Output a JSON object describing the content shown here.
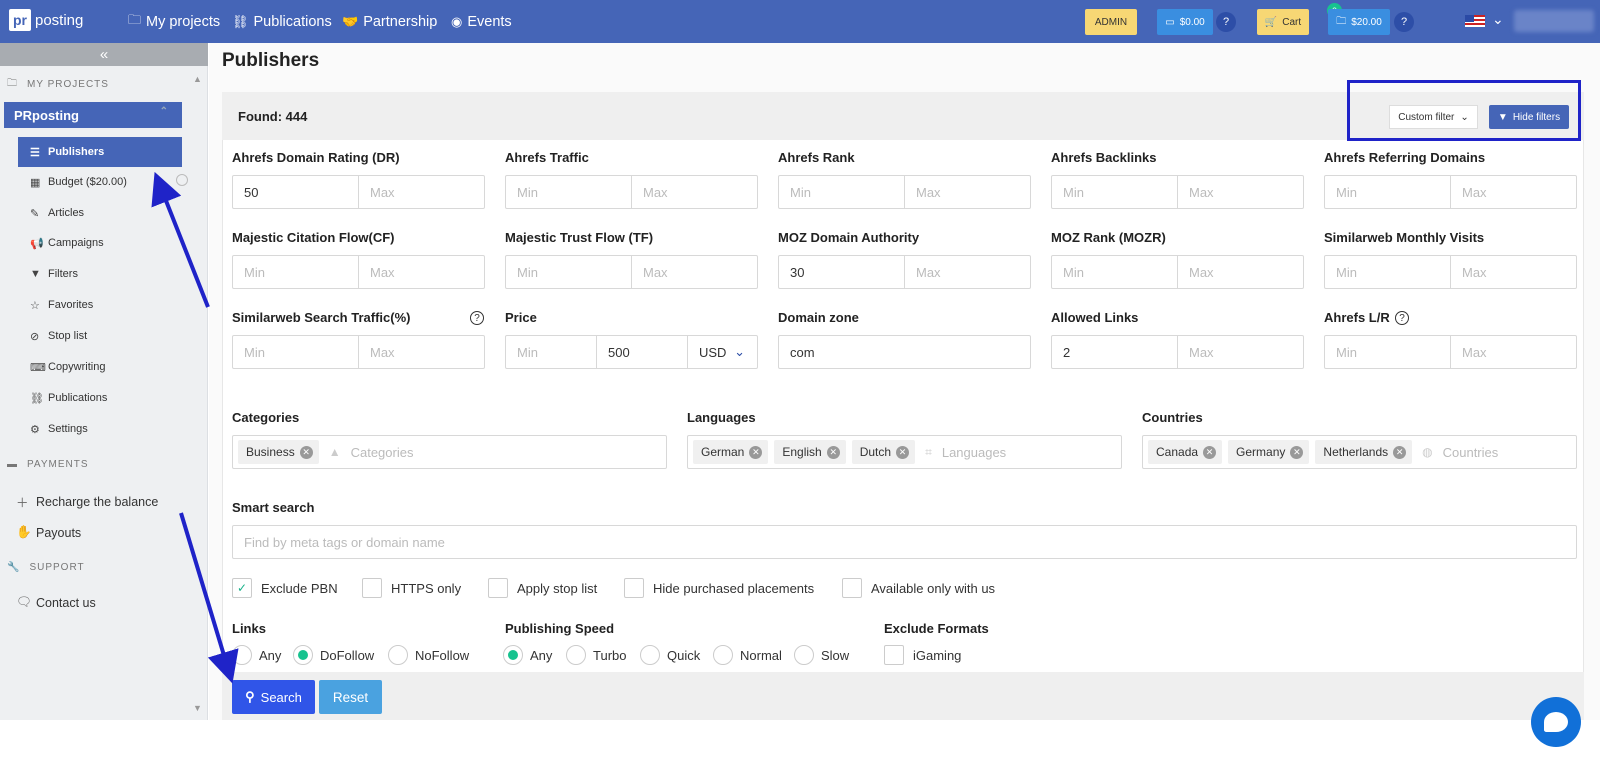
{
  "header": {
    "logo_mark": "pr",
    "logo_text": "posting",
    "nav": [
      {
        "label": "My projects"
      },
      {
        "label": "Publications"
      },
      {
        "label": "Partnership"
      },
      {
        "label": "Events"
      }
    ],
    "admin_label": "ADMIN",
    "balance_label": "$0.00",
    "cart_label": "Cart",
    "cart_count": "0",
    "project_balance_label": "$20.00"
  },
  "sidebar": {
    "collapse_icon": "«",
    "section_projects": "MY PROJECTS",
    "project_name": "PRposting",
    "items": [
      {
        "label": "Publishers"
      },
      {
        "label": "Budget ($20.00)"
      },
      {
        "label": "Articles"
      },
      {
        "label": "Campaigns"
      },
      {
        "label": "Filters"
      },
      {
        "label": "Favorites"
      },
      {
        "label": "Stop list"
      },
      {
        "label": "Copywriting"
      },
      {
        "label": "Publications"
      },
      {
        "label": "Settings"
      }
    ],
    "section_payments": "PAYMENTS",
    "recharge_label": "Recharge the balance",
    "payouts_label": "Payouts",
    "section_support": "SUPPORT",
    "contact_label": "Contact us"
  },
  "main": {
    "title": "Publishers",
    "found": "Found: 444",
    "custom_filter_label": "Custom filter",
    "hide_filters_label": "Hide filters"
  },
  "filters": {
    "min_ph": "Min",
    "max_ph": "Max",
    "dr": {
      "label": "Ahrefs Domain Rating (DR)",
      "min": "50"
    },
    "traffic": {
      "label": "Ahrefs Traffic"
    },
    "rank": {
      "label": "Ahrefs Rank"
    },
    "backlinks": {
      "label": "Ahrefs Backlinks"
    },
    "refdomains": {
      "label": "Ahrefs Referring Domains"
    },
    "cf": {
      "label": "Majestic Citation Flow(CF)"
    },
    "tf": {
      "label": "Majestic Trust Flow (TF)"
    },
    "da": {
      "label": "MOZ Domain Authority",
      "min": "30"
    },
    "mozr": {
      "label": "MOZ Rank (MOZR)"
    },
    "smv": {
      "label": "Similarweb Monthly Visits"
    },
    "sst": {
      "label": "Similarweb Search Traffic(%)"
    },
    "price": {
      "label": "Price",
      "max": "500",
      "currency": "USD"
    },
    "zone": {
      "label": "Domain zone",
      "value": "com"
    },
    "allowed": {
      "label": "Allowed Links",
      "min": "2"
    },
    "lr": {
      "label": "Ahrefs L/R"
    },
    "categories": {
      "label": "Categories",
      "tags": [
        "Business"
      ],
      "placeholder": "Categories"
    },
    "languages": {
      "label": "Languages",
      "tags": [
        "German",
        "English",
        "Dutch"
      ],
      "placeholder": "Languages"
    },
    "countries": {
      "label": "Countries",
      "tags": [
        "Canada",
        "Germany",
        "Netherlands"
      ],
      "placeholder": "Countries"
    },
    "smart": {
      "label": "Smart search",
      "placeholder": "Find by meta tags or domain name"
    },
    "checkboxes": [
      {
        "label": "Exclude PBN",
        "checked": true
      },
      {
        "label": "HTTPS only",
        "checked": false
      },
      {
        "label": "Apply stop list",
        "checked": false
      },
      {
        "label": "Hide purchased placements",
        "checked": false
      },
      {
        "label": "Available only with us",
        "checked": false
      }
    ],
    "links": {
      "label": "Links",
      "options": [
        "Any",
        "DoFollow",
        "NoFollow"
      ],
      "selected": "DoFollow"
    },
    "speed": {
      "label": "Publishing Speed",
      "options": [
        "Any",
        "Turbo",
        "Quick",
        "Normal",
        "Slow"
      ],
      "selected": "Any"
    },
    "formats": {
      "label": "Exclude Formats",
      "options": [
        "iGaming"
      ]
    }
  },
  "actions": {
    "search_label": "Search",
    "reset_label": "Reset"
  },
  "colors": {
    "brand": "#4565b7",
    "accent_green": "#17c38f",
    "search_blue": "#3055e8",
    "reset_blue": "#4aa2e0",
    "annotation": "#1f23c8"
  }
}
